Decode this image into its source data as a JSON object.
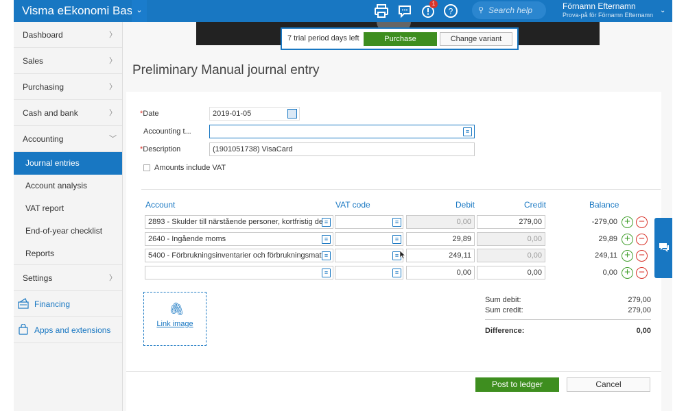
{
  "topbar": {
    "app_title": "Visma eEkonomi Bas",
    "dropdown_chevron": "⌄",
    "notification_count": "1",
    "search_placeholder": "Search help",
    "user_name": "Förnamn Efternamn",
    "user_subtitle": "Prova-på för Förnamn Efternamn",
    "icons": [
      "print-icon",
      "chat-bubble-icon",
      "alert-icon",
      "help-icon",
      "search-icon"
    ]
  },
  "sidebar": {
    "items": [
      {
        "label": "Dashboard"
      },
      {
        "label": "Sales"
      },
      {
        "label": "Purchasing"
      },
      {
        "label": "Cash and bank"
      },
      {
        "label": "Accounting"
      }
    ],
    "accounting_sub": [
      {
        "label": "Journal entries",
        "active": true
      },
      {
        "label": "Account analysis"
      },
      {
        "label": "VAT report"
      },
      {
        "label": "End-of-year checklist"
      },
      {
        "label": "Reports"
      }
    ],
    "settings": {
      "label": "Settings"
    },
    "financing": {
      "label": "Financing"
    },
    "apps": {
      "label": "Apps and extensions"
    }
  },
  "trial": {
    "text": "7 trial period days left",
    "purchase_label": "Purchase",
    "change_label": "Change variant"
  },
  "page": {
    "title": "Preliminary Manual journal entry"
  },
  "form": {
    "date_label": "Date",
    "date_value": "2019-01-05",
    "accounting_label": "Accounting t...",
    "accounting_value": "",
    "description_label": "Description",
    "description_value": "(1901051738) VisaCard",
    "vat_checkbox_label": "Amounts include VAT",
    "vat_checkbox_checked": false
  },
  "table": {
    "headers": {
      "account": "Account",
      "vat": "VAT code",
      "debit": "Debit",
      "credit": "Credit",
      "balance": "Balance"
    },
    "rows": [
      {
        "account": "2893 - Skulder till närstående personer, kortfristig de",
        "vat": "",
        "debit": "0,00",
        "credit": "279,00",
        "balance": "-279,00",
        "debit_readonly": true,
        "credit_readonly": false
      },
      {
        "account": "2640 - Ingående moms",
        "vat": "",
        "debit": "29,89",
        "credit": "0,00",
        "balance": "29,89",
        "debit_readonly": false,
        "credit_readonly": true
      },
      {
        "account": "5400 - Förbrukningsinventarier och förbrukningsmat",
        "vat": "",
        "debit": "249,11",
        "credit": "0,00",
        "balance": "249,11",
        "debit_readonly": false,
        "credit_readonly": true
      },
      {
        "account": "",
        "vat": "",
        "debit": "0,00",
        "credit": "0,00",
        "balance": "0,00",
        "debit_readonly": false,
        "credit_readonly": false
      }
    ]
  },
  "attachment": {
    "link_label": "Link image"
  },
  "summary": {
    "sum_debit_label": "Sum debit:",
    "sum_debit_value": "279,00",
    "sum_credit_label": "Sum credit:",
    "sum_credit_value": "279,00",
    "difference_label": "Difference:",
    "difference_value": "0,00"
  },
  "actions": {
    "post_label": "Post to ledger",
    "cancel_label": "Cancel"
  },
  "colors": {
    "brand_blue": "#1877c2",
    "primary_green": "#3e8e1f",
    "remove_red": "#d9342b",
    "add_green": "#43a02f"
  }
}
